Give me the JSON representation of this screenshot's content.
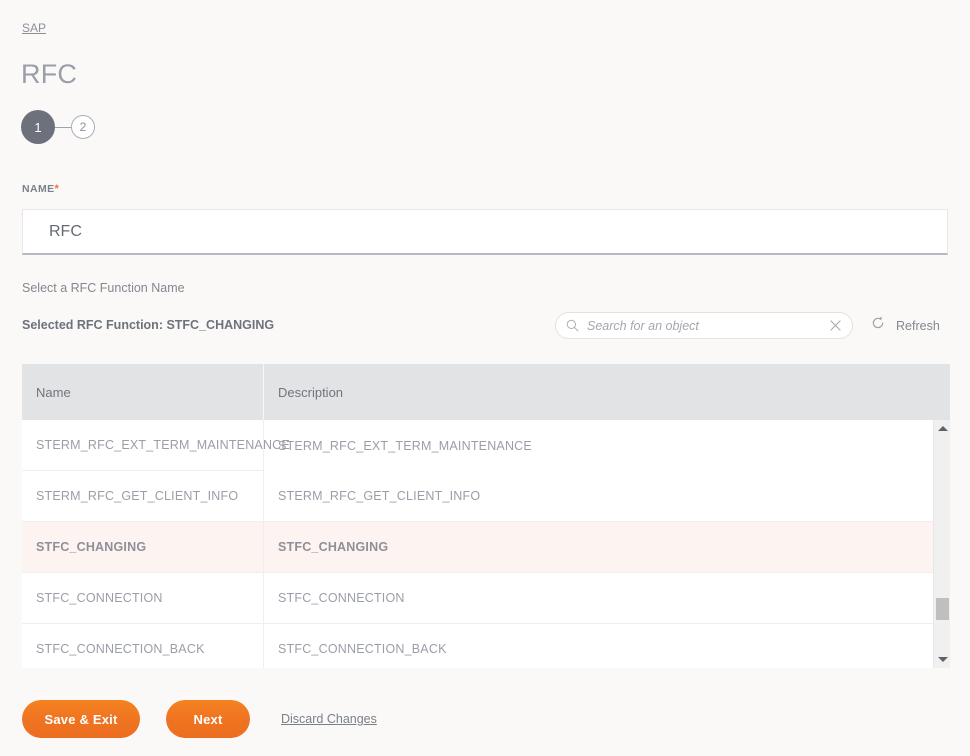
{
  "breadcrumb": {
    "label": "SAP"
  },
  "header": {
    "title": "RFC"
  },
  "stepper": {
    "steps": [
      {
        "label": "1",
        "state": "active"
      },
      {
        "label": "2",
        "state": "inactive"
      }
    ]
  },
  "form": {
    "name_label": "NAME",
    "required_marker": "*",
    "name_value": "RFC",
    "name_placeholder": "",
    "hint": "Select a RFC Function Name",
    "selected_function": "Selected RFC Function: STFC_CHANGING"
  },
  "search": {
    "placeholder": "Search for an object",
    "value": "",
    "icon": "search-icon",
    "clear_icon": "close-icon"
  },
  "refresh": {
    "label": "Refresh",
    "icon": "refresh-icon"
  },
  "table": {
    "columns": [
      "Name",
      "Description"
    ],
    "rows": [
      {
        "name": "STERM_RFC_EXT_TERM_MAINTENANCE",
        "description": "STERM_RFC_EXT_TERM_MAINTENANCE",
        "selected": false
      },
      {
        "name": "STERM_RFC_GET_CLIENT_INFO",
        "description": "STERM_RFC_GET_CLIENT_INFO",
        "selected": false
      },
      {
        "name": "STFC_CHANGING",
        "description": "STFC_CHANGING",
        "selected": true
      },
      {
        "name": "STFC_CONNECTION",
        "description": "STFC_CONNECTION",
        "selected": false
      },
      {
        "name": "STFC_CONNECTION_BACK",
        "description": "STFC_CONNECTION_BACK",
        "selected": false
      }
    ]
  },
  "scrollbar": {
    "up_icon": "triangle-up-icon",
    "down_icon": "triangle-down-icon"
  },
  "footer": {
    "save_label": "Save & Exit",
    "next_label": "Next",
    "discard_label": "Discard Changes"
  },
  "colors": {
    "accent": "#ef7321",
    "background": "#faf9f8",
    "header_gray": "#e2e3e5",
    "selected_row": "#fdf4f1",
    "text_muted": "#9a9ea7",
    "required_star": "#f0703a"
  }
}
